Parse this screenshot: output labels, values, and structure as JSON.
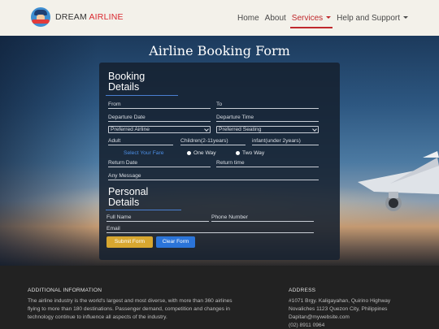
{
  "navbar": {
    "brand_part1": "DREAM",
    "brand_part2": "AIRLINE",
    "logo_icon": "pilot-logo-icon",
    "links": [
      {
        "label": "Home"
      },
      {
        "label": "About"
      },
      {
        "label": "Services",
        "active": true,
        "dropdown": true
      },
      {
        "label": "Help and Support",
        "dropdown": true
      }
    ]
  },
  "hero": {
    "title": "Airline Booking Form"
  },
  "form": {
    "booking_title_line1": "Booking",
    "booking_title_line2": "Details",
    "from_placeholder": "From",
    "to_placeholder": "To",
    "departure_date_placeholder": "Departure Date",
    "departure_time_placeholder": "Departure Time",
    "preferred_airline": "Preferred Airline",
    "preferred_seating": "Preferred Seating",
    "adult_placeholder": "Adult",
    "children_placeholder": "Children(2-11years)",
    "infant_placeholder": "infant(under 2years)",
    "fare_label": "Select Your Fare",
    "one_way_label": "One Way",
    "two_way_label": "Two Way",
    "return_date_placeholder": "Return Date",
    "return_time_placeholder": "Return time",
    "message_placeholder": "Any Message",
    "personal_title_line1": "Personal",
    "personal_title_line2": "Details",
    "full_name_placeholder": "Full Name",
    "phone_placeholder": "Phone Number",
    "email_placeholder": "Email",
    "submit_label": "Submit Form",
    "clear_label": "Clear Form"
  },
  "footer": {
    "info_heading": "ADDITIONAL INFORMATION",
    "info_lines": [
      "The airline industry is the world's largest and most diverse, with more than 360 airlines",
      "flying to more than 180 destinations. Passenger demand, competition and changes in",
      "technology continue to influence all aspects of the industry."
    ],
    "address_heading": "ADDRESS",
    "address_lines": [
      "#1071 Brgy. Kaligayahan, Quirino Highway",
      "Novaliches 1123 Quezon City, Philippines",
      "Dapitan@mywebsite.com",
      "(02) 8911 0964"
    ]
  },
  "colors": {
    "accent_red": "#c0282d",
    "submit_yellow": "#d8a730",
    "clear_blue": "#2b74d9",
    "fare_blue": "#4d8fe6"
  }
}
